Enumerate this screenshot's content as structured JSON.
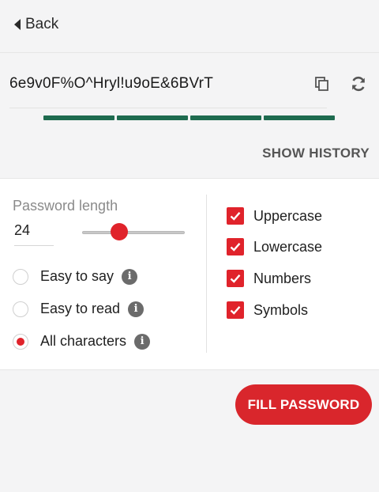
{
  "nav": {
    "back_label": "Back"
  },
  "password": {
    "value": "6e9v0F%O^Hryl!u9oE&6BVrT",
    "strength_segments": 4,
    "show_history_label": "SHOW HISTORY"
  },
  "options": {
    "length_label": "Password length",
    "length_value": "24",
    "slider_level": 0.28,
    "modes": [
      {
        "label": "Easy to say",
        "selected": false
      },
      {
        "label": "Easy to read",
        "selected": false
      },
      {
        "label": "All characters",
        "selected": true
      }
    ],
    "charsets": [
      {
        "label": "Uppercase",
        "checked": true
      },
      {
        "label": "Lowercase",
        "checked": true
      },
      {
        "label": "Numbers",
        "checked": true
      },
      {
        "label": "Symbols",
        "checked": true
      }
    ],
    "info_glyph": "i"
  },
  "actions": {
    "fill_label": "FILL PASSWORD"
  },
  "colors": {
    "accent": "#e0232b",
    "strength": "#1e6b4f"
  }
}
